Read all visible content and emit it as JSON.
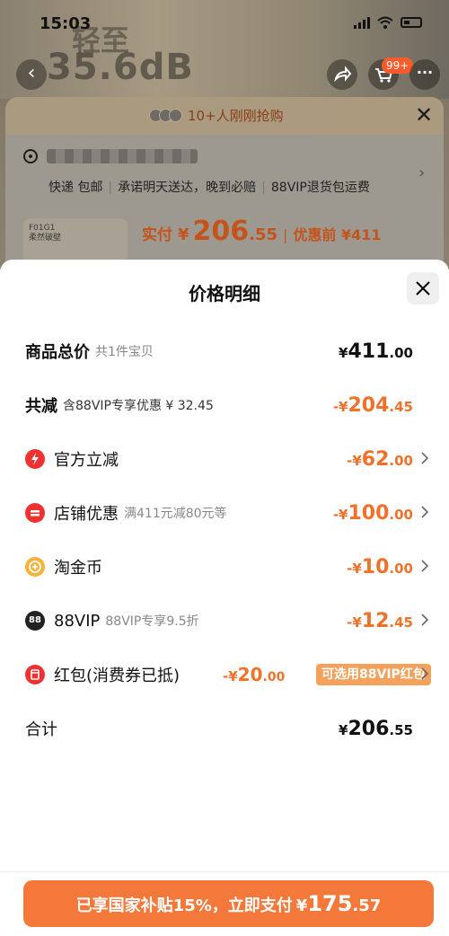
{
  "status_bar": {
    "time": "15:03"
  },
  "background": {
    "product_top_text": "轻至",
    "product_noise_text": "35.6dB",
    "cart_badge": "99+",
    "rush_text": "10+人刚刚抢购",
    "shipping": [
      "快递 包邮",
      "承诺明天送达，晚到必赔",
      "88VIP退货包运费"
    ],
    "thumb_text": "F01G1\n柔然破壁",
    "actual_price_label": "实付",
    "actual_price_currency": "¥",
    "actual_price_int": "206",
    "actual_price_dec": ".55",
    "pre_discount": "优惠前 ¥411"
  },
  "sheet": {
    "title": "价格明细",
    "rows": {
      "total": {
        "label": "商品总价",
        "sub": "共1件宝贝",
        "cur": "¥",
        "int": "411",
        "dec": ".00"
      },
      "reduce": {
        "label": "共减",
        "sub": "含88VIP专享优惠 ¥ 32.45",
        "cur": "-¥",
        "int": "204",
        "dec": ".45"
      },
      "official": {
        "label": "官方立减",
        "cur": "-¥",
        "int": "62",
        "dec": ".00"
      },
      "shop": {
        "label": "店铺优惠",
        "sub": "满411元减80元等",
        "cur": "-¥",
        "int": "100",
        "dec": ".00"
      },
      "coin": {
        "label": "淘金币",
        "cur": "-¥",
        "int": "10",
        "dec": ".00"
      },
      "vip": {
        "icon_text": "88",
        "label": "88VIP",
        "sub": "88VIP专享9.5折",
        "cur": "-¥",
        "int": "12",
        "dec": ".45"
      },
      "redpack": {
        "label": "红包(消费券已抵)",
        "cur": "-¥",
        "int": "20",
        "dec": ".00",
        "tag": "可选用88VIP红包"
      },
      "sum": {
        "label": "合计",
        "cur": "¥",
        "int": "206",
        "dec": ".55"
      }
    }
  },
  "pay_button": {
    "text": "已享国家补贴15%，立即支付",
    "cur": "¥",
    "int": "175",
    "dec": ".57"
  },
  "colors": {
    "accent": "#f0722a",
    "pay_button": "#f3783a",
    "icon_red": "#ee3131",
    "icon_coin": "#f6b23a"
  }
}
